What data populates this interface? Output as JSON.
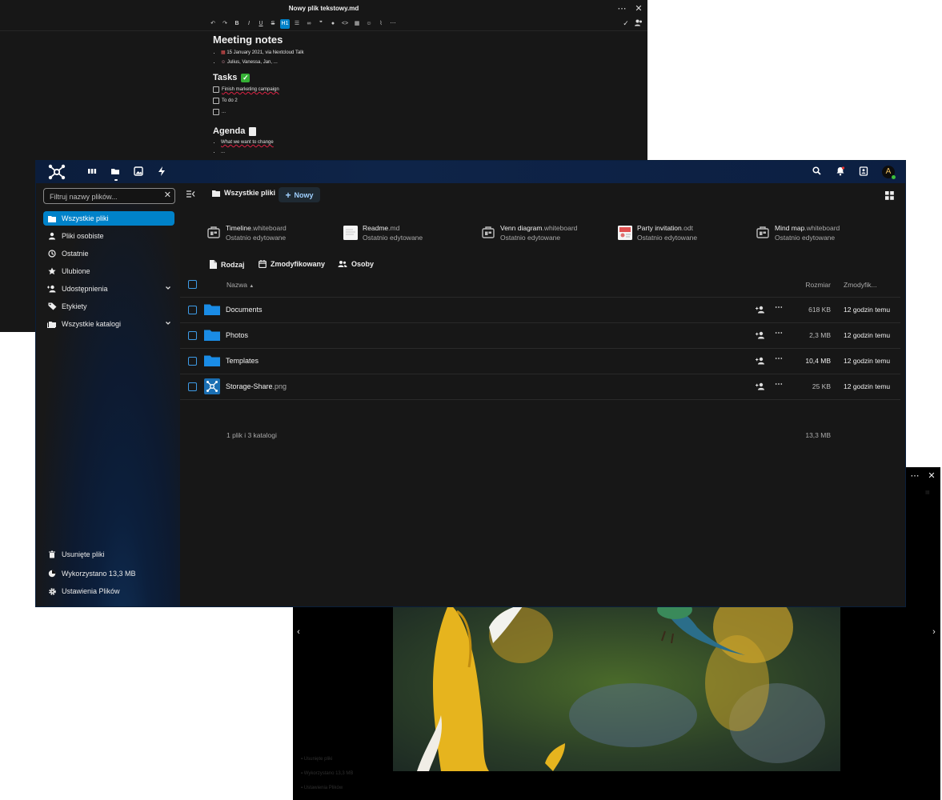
{
  "editor": {
    "title": "Nowy plik tekstowy.md",
    "heading": "Meeting notes",
    "meta": [
      "15 January 2021, via Nextcloud Talk",
      "Julius, Vanessa, Jan, ..."
    ],
    "tasks_title": "Tasks",
    "tasks": [
      "Finish marketing campaign",
      "To do 2",
      "..."
    ],
    "agenda_title": "Agenda",
    "agenda": [
      "What we want to change",
      "..."
    ],
    "heading_button": "H1"
  },
  "files": {
    "header": {
      "apps": [
        "dashboard-icon",
        "files-icon",
        "photos-icon",
        "activity-icon"
      ],
      "avatar_initial": "A"
    },
    "sidebar": {
      "filter_placeholder": "Filtruj nazwy plików...",
      "items": [
        {
          "label": "Wszystkie pliki",
          "icon": "folder-icon",
          "active": true
        },
        {
          "label": "Pliki osobiste",
          "icon": "person-icon"
        },
        {
          "label": "Ostatnie",
          "icon": "history-icon"
        },
        {
          "label": "Ulubione",
          "icon": "star-icon"
        },
        {
          "label": "Udostępnienia",
          "icon": "share-icon",
          "expandable": true
        },
        {
          "label": "Etykiety",
          "icon": "tag-icon"
        },
        {
          "label": "Wszystkie katalogi",
          "icon": "folders-icon",
          "expandable": true
        }
      ],
      "footer": [
        {
          "label": "Usunięte pliki",
          "icon": "trash-icon"
        },
        {
          "label": "Wykorzystano 13,3 MB",
          "icon": "chart-pie-icon"
        },
        {
          "label": "Ustawienia Plików",
          "icon": "gear-icon"
        }
      ]
    },
    "breadcrumb": "Wszystkie pliki",
    "new_button": "Nowy",
    "recent": [
      {
        "name": "Timeline",
        "ext": ".whiteboard",
        "sub": "Ostatnio edytowane",
        "icon": "whiteboard-icon"
      },
      {
        "name": "Readme",
        "ext": ".md",
        "sub": "Ostatnio edytowane",
        "icon": "document-icon"
      },
      {
        "name": "Venn diagram",
        "ext": ".whiteboard",
        "sub": "Ostatnio edytowane",
        "icon": "whiteboard-icon"
      },
      {
        "name": "Party invitation",
        "ext": ".odt",
        "sub": "Ostatnio edytowane",
        "icon": "odt-icon"
      },
      {
        "name": "Mind map",
        "ext": ".whiteboard",
        "sub": "Ostatnio edytowane",
        "icon": "whiteboard-icon"
      }
    ],
    "filters": [
      "Rodzaj",
      "Zmodyfikowany",
      "Osoby"
    ],
    "columns": {
      "name": "Nazwa",
      "size": "Rozmiar",
      "modified": "Zmodyfik..."
    },
    "rows": [
      {
        "name": "Documents",
        "ext": "",
        "size": "618 KB",
        "modified": "12 godzin temu",
        "type": "folder"
      },
      {
        "name": "Photos",
        "ext": "",
        "size": "2,3 MB",
        "modified": "12 godzin temu",
        "type": "folder"
      },
      {
        "name": "Templates",
        "ext": "",
        "size": "10,4 MB",
        "modified": "12 godzin temu",
        "type": "folder"
      },
      {
        "name": "Storage-Share",
        "ext": ".png",
        "size": "25 KB",
        "modified": "12 godzin temu",
        "type": "image"
      }
    ],
    "summary": {
      "count": "1 plik i 3 katalogi",
      "total": "13,3 MB"
    }
  },
  "colors": {
    "accent": "#0082c9",
    "folder": "#1a8ce6",
    "header": "#0e2448"
  }
}
